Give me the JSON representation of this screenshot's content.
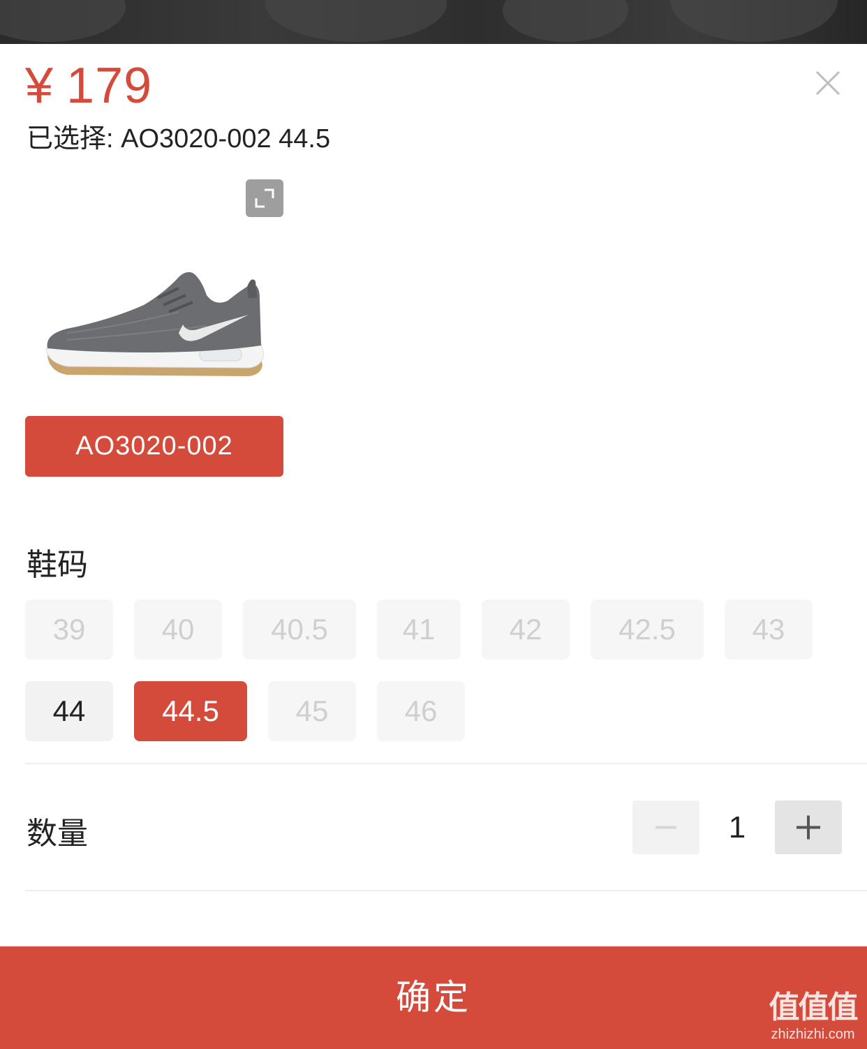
{
  "product": {
    "currency_symbol": "¥",
    "price": "179",
    "selected_text": "已选择: AO3020-002 44.5"
  },
  "variant": {
    "label": "AO3020-002"
  },
  "size_section": {
    "label": "鞋码",
    "sizes": [
      {
        "label": "39",
        "state": "disabled"
      },
      {
        "label": "40",
        "state": "disabled"
      },
      {
        "label": "40.5",
        "state": "disabled"
      },
      {
        "label": "41",
        "state": "disabled"
      },
      {
        "label": "42",
        "state": "disabled"
      },
      {
        "label": "42.5",
        "state": "disabled"
      },
      {
        "label": "43",
        "state": "disabled"
      },
      {
        "label": "44",
        "state": "available"
      },
      {
        "label": "44.5",
        "state": "selected"
      },
      {
        "label": "45",
        "state": "disabled"
      },
      {
        "label": "46",
        "state": "disabled"
      }
    ]
  },
  "quantity": {
    "label": "数量",
    "value": "1"
  },
  "confirm": {
    "label": "确定"
  },
  "watermark": {
    "logo": "值值值",
    "url": "zhizhizhi.com"
  },
  "colors": {
    "accent": "#d54b3b",
    "disabled_text": "#cfcfcf",
    "chip_bg": "#f6f6f6"
  }
}
